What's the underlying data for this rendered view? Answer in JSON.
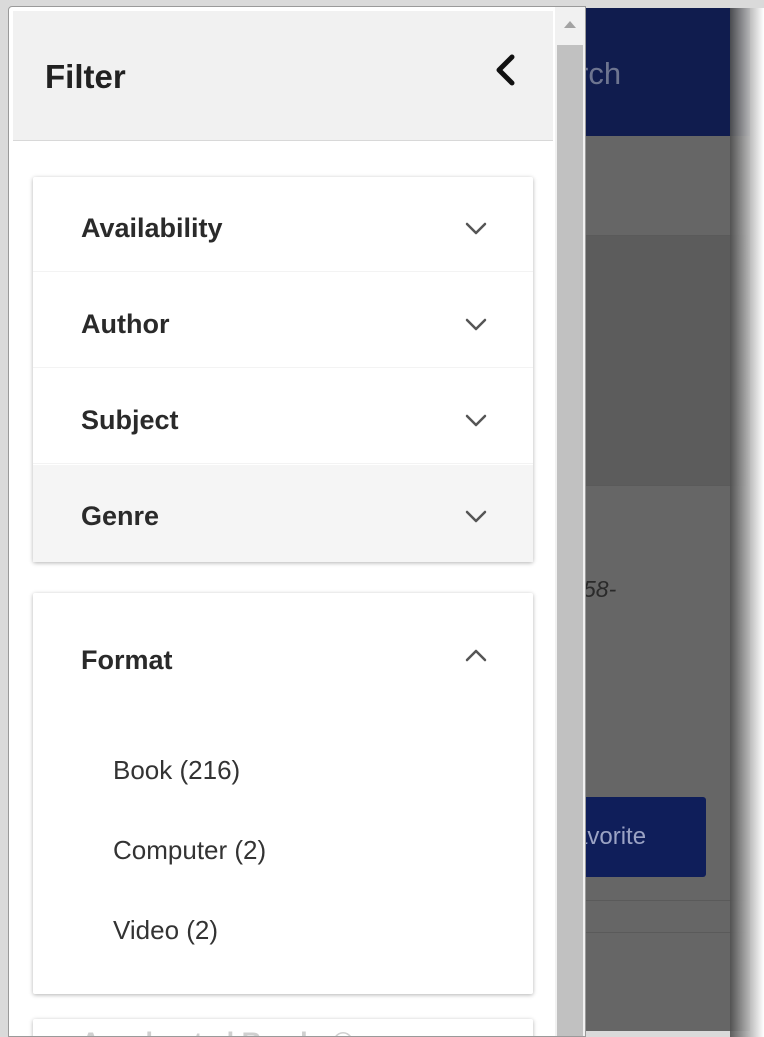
{
  "background": {
    "header_text": "rch",
    "isbn_fragment": "58-",
    "favorite_button_label": "avorite"
  },
  "drawer": {
    "title": "Filter",
    "collapse_icon": "chevron-left-icon",
    "sections": [
      {
        "label": "Availability",
        "expanded": false
      },
      {
        "label": "Author",
        "expanded": false
      },
      {
        "label": "Subject",
        "expanded": false
      },
      {
        "label": "Genre",
        "expanded": false
      }
    ],
    "format": {
      "label": "Format",
      "expanded": true,
      "options": [
        {
          "label": "Book (216)"
        },
        {
          "label": "Computer (2)"
        },
        {
          "label": "Video (2)"
        }
      ]
    },
    "next_section": {
      "label": "Accelerated Reader®"
    }
  },
  "colors": {
    "header_bg": "#101c4e",
    "button_bg": "#0f1e5a",
    "drawer_header_bg": "#f1f1f1"
  }
}
